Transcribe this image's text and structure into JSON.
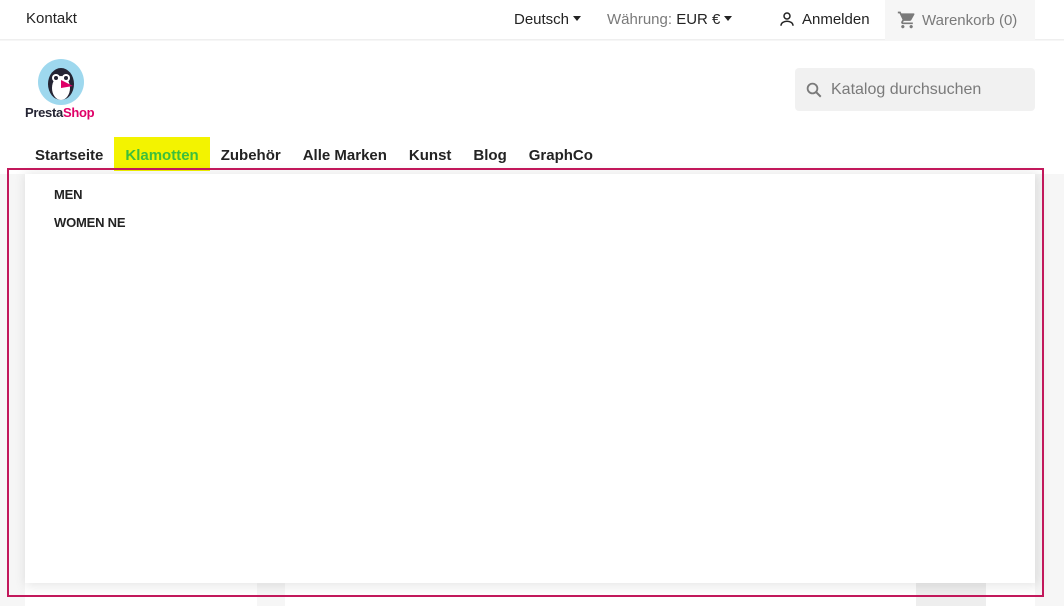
{
  "topbar": {
    "contact": "Kontakt",
    "language": "Deutsch",
    "currency_label": "Währung:",
    "currency_value": "EUR €",
    "signin": "Anmelden",
    "cart": "Warenkorb (0)"
  },
  "logo": {
    "part1": "Presta",
    "part2": "Shop"
  },
  "search": {
    "placeholder": "Katalog durchsuchen"
  },
  "nav": {
    "items": [
      "Startseite",
      "Klamotten",
      "Zubehör",
      "Alle Marken",
      "Kunst",
      "Blog",
      "GraphCo"
    ],
    "active": "Klamotten"
  },
  "dropdown": {
    "items": [
      "MEN",
      "WOMEN NE"
    ]
  },
  "colors": {
    "highlight": "#f3f300",
    "frame": "#c2185b",
    "brand_pink": "#df0067"
  }
}
